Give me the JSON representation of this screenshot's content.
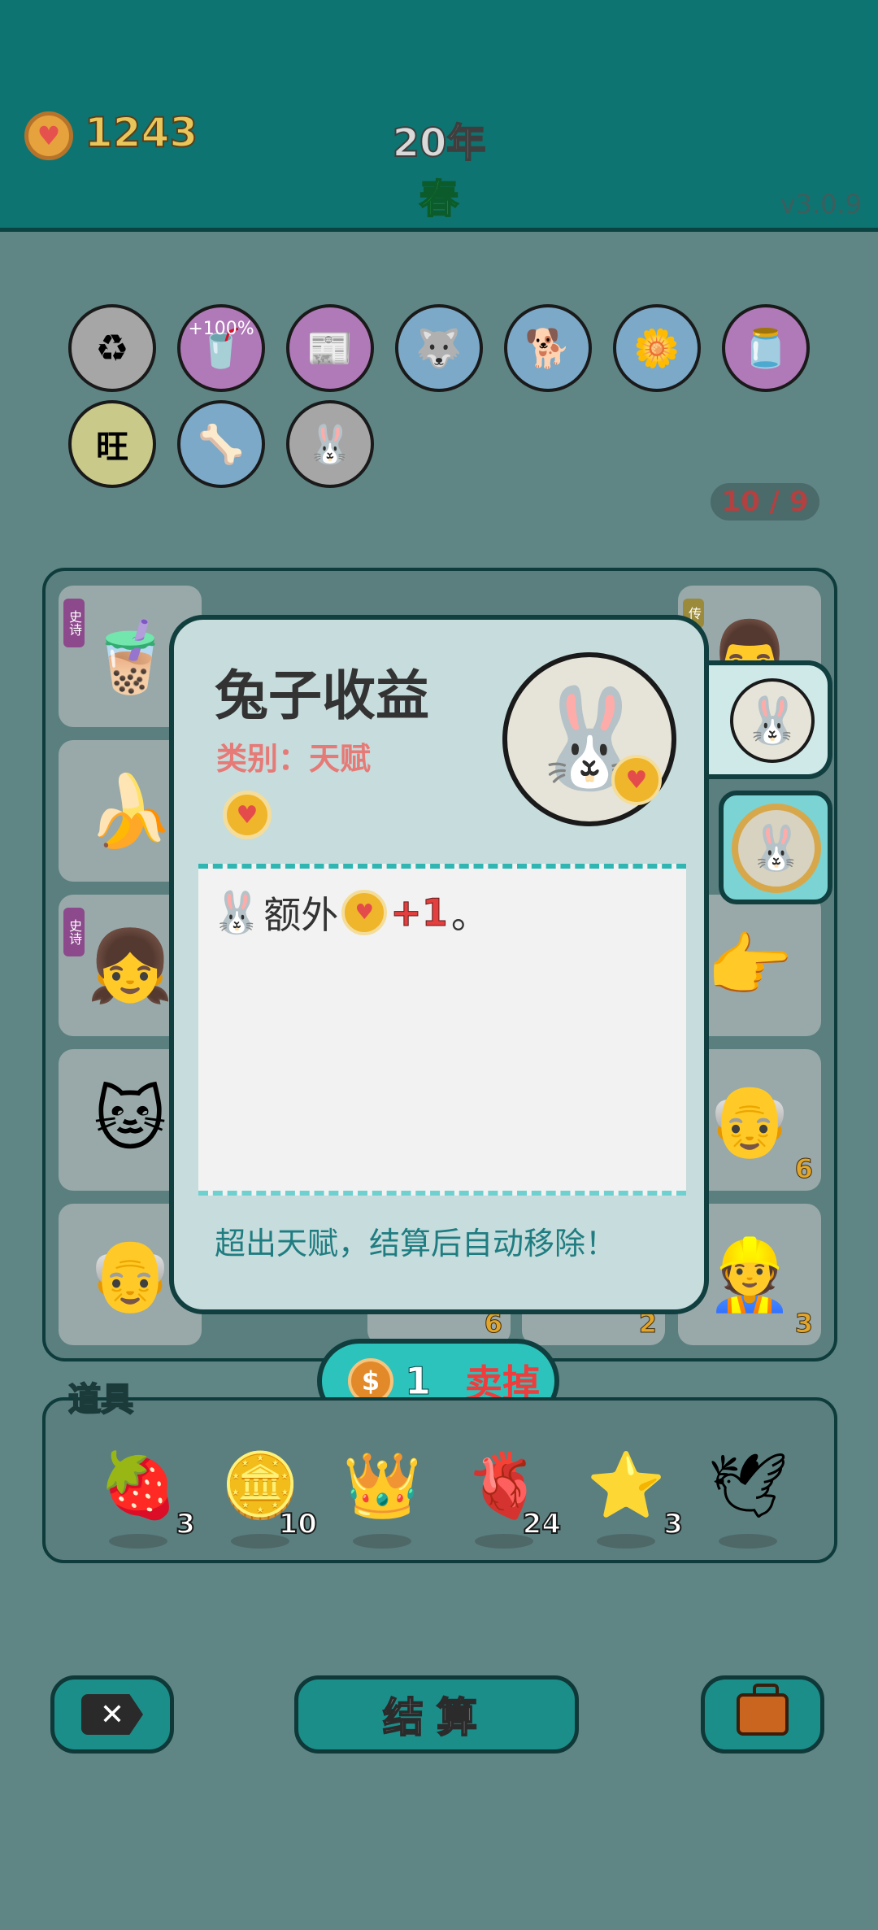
{
  "header": {
    "coins": "1243",
    "year": "20年",
    "season": "春",
    "version": "v3.0.9"
  },
  "talents": {
    "row1": [
      {
        "icon": "trash-bag-icon",
        "glyph": "♻"
      },
      {
        "icon": "boost-cup-icon",
        "glyph": "🥤",
        "label": "+100%"
      },
      {
        "icon": "time-magazine-icon",
        "glyph": "📰"
      },
      {
        "icon": "husky-icon",
        "glyph": "🐺"
      },
      {
        "icon": "dog-with-chain-icon",
        "glyph": "🐕"
      },
      {
        "icon": "flower-pot-icon",
        "glyph": "🌼"
      },
      {
        "icon": "jar-icon",
        "glyph": "🫙"
      }
    ],
    "row2": [
      {
        "icon": "wang-tiles-icon",
        "glyph": "旺"
      },
      {
        "icon": "dog-bowl-icon",
        "glyph": "🦴"
      },
      {
        "icon": "rabbit-icon",
        "glyph": "🐰"
      }
    ],
    "counter": "10 / 9"
  },
  "board": {
    "cells": [
      {
        "icon": "bubble-tea-icon",
        "glyph": "🧋",
        "tag": "史诗"
      },
      {
        "icon": "unknown-icon",
        "glyph": "",
        "tag": "史"
      },
      {
        "icon": "unknown-icon",
        "glyph": ""
      },
      {
        "icon": "unknown-icon",
        "glyph": ""
      },
      {
        "icon": "man-face-icon",
        "glyph": "👨",
        "tag": "传"
      },
      {
        "icon": "banana-icon",
        "glyph": "🍌"
      },
      {
        "icon": "pointing-hand-icon",
        "glyph": "👉"
      },
      {
        "icon": "girl-face-icon",
        "glyph": "👧",
        "tag": "史诗"
      },
      {
        "icon": "bald-man-icon",
        "glyph": "👴",
        "num": "6"
      },
      {
        "icon": "cat-icon",
        "glyph": "🐱"
      },
      {
        "icon": "grandpa-icon",
        "glyph": "👴"
      },
      {
        "icon": "worker-icon",
        "glyph": "👷",
        "num": "3"
      }
    ],
    "bottom_numbers": [
      "6",
      "2"
    ]
  },
  "modal": {
    "title": "兔子收益",
    "category": "类别：天赋",
    "desc_prefix": "额外",
    "desc_plus": "+1",
    "desc_suffix": "。",
    "footer": "超出天赋，结算后自动移除！"
  },
  "sell": {
    "coin_symbol": "$",
    "price": "1",
    "label": "卖掉"
  },
  "items": {
    "title": "道具",
    "list": [
      {
        "icon": "lychee-icon",
        "glyph": "🍓",
        "qty": "3"
      },
      {
        "icon": "dollar-coin-icon",
        "glyph": "🪙",
        "qty": "10"
      },
      {
        "icon": "crown-icon",
        "glyph": "👑",
        "qty": ""
      },
      {
        "icon": "liver-icon",
        "glyph": "🫀",
        "qty": "24"
      },
      {
        "icon": "star-icon",
        "glyph": "⭐",
        "qty": "3"
      },
      {
        "icon": "pigeon-icon",
        "glyph": "🕊",
        "qty": ""
      }
    ]
  },
  "bottom": {
    "close_glyph": "✕",
    "settle_label": "结算"
  },
  "colors": {
    "header_bg": "#0e7471",
    "dim_bg": "#5f8585",
    "modal_bg": "#c7dcdc",
    "accent_red": "#e33f3f",
    "teal_button": "#2dc3bd"
  }
}
